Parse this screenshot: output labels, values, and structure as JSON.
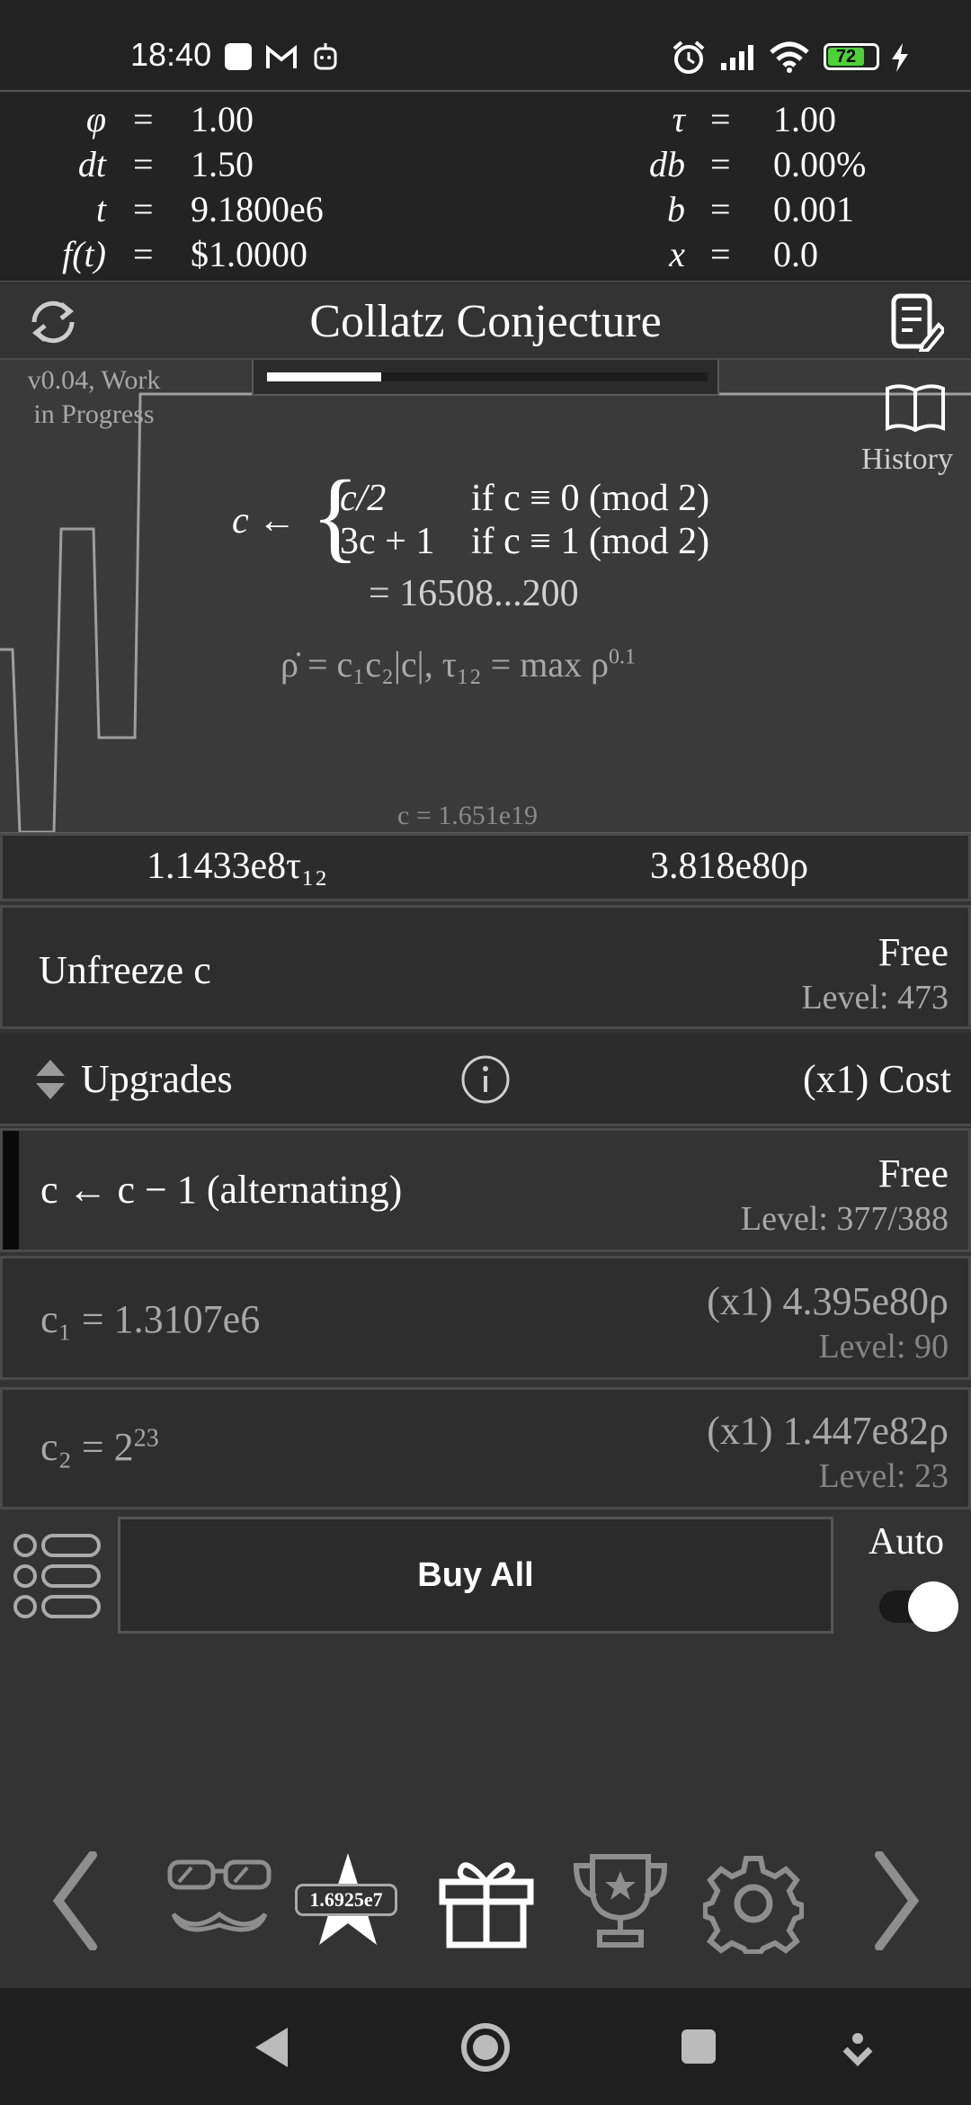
{
  "status_bar": {
    "time": "18:40",
    "battery": "72",
    "icons": [
      "zalo-icon",
      "gmail-icon",
      "bot-icon",
      "alarm-icon",
      "signal-icon",
      "wifi-icon",
      "battery-icon",
      "charging-icon"
    ]
  },
  "stats": {
    "left": [
      {
        "name": "φ",
        "value": "1.00"
      },
      {
        "name": "dt",
        "value": "1.50"
      },
      {
        "name": "t",
        "value": "9.1800e6"
      },
      {
        "name": "f(t)",
        "value": "$1.0000"
      }
    ],
    "right": [
      {
        "name": "τ",
        "value": "1.00"
      },
      {
        "name": "db",
        "value": "0.00%"
      },
      {
        "name": "b",
        "value": "0.001"
      },
      {
        "name": "x",
        "value": "0.0"
      }
    ],
    "eq": "="
  },
  "header": {
    "title": "Collatz Conjecture",
    "progress": 0.26
  },
  "graph": {
    "version": "v0.04, Work",
    "version2": "in Progress",
    "history_label": "History",
    "formula_lhs": "c ←",
    "case1_expr": "c/2",
    "case1_cond": "if c ≡ 0 (mod 2)",
    "case2_expr": "3c + 1",
    "case2_cond": "if c ≡ 1 (mod 2)",
    "value_line": "= 16508...200",
    "rho_formula": "ρ̇ = c₁c₂|c|,   τ₁₂ = max ρ",
    "rho_exp": "0.1",
    "c_value": "c = 1.651e19"
  },
  "tau_bar": {
    "tau_value": "1.1433e8τ₁₂",
    "rho_value": "3.818e80ρ"
  },
  "unfreeze": {
    "label": "Unfreeze c",
    "price": "Free",
    "level": "Level: 473"
  },
  "upgrades_header": {
    "label": "Upgrades",
    "cost_label": "(x1) Cost"
  },
  "upgrades": [
    {
      "label": "c ← c − 1 (alternating)",
      "price": "Free",
      "level": "Level: 377/388"
    },
    {
      "label": "c₁ = 1.3107e6",
      "price": "(x1) 4.395e80ρ",
      "level": "Level: 90"
    },
    {
      "label_base": "c₂ = 2",
      "label_exp": "23",
      "price": "(x1) 1.447e82ρ",
      "level": "Level: 23"
    }
  ],
  "buy_all": {
    "label": "Buy All",
    "auto_label": "Auto"
  },
  "bottom_bar": {
    "stars_count": "1.6925e7"
  }
}
